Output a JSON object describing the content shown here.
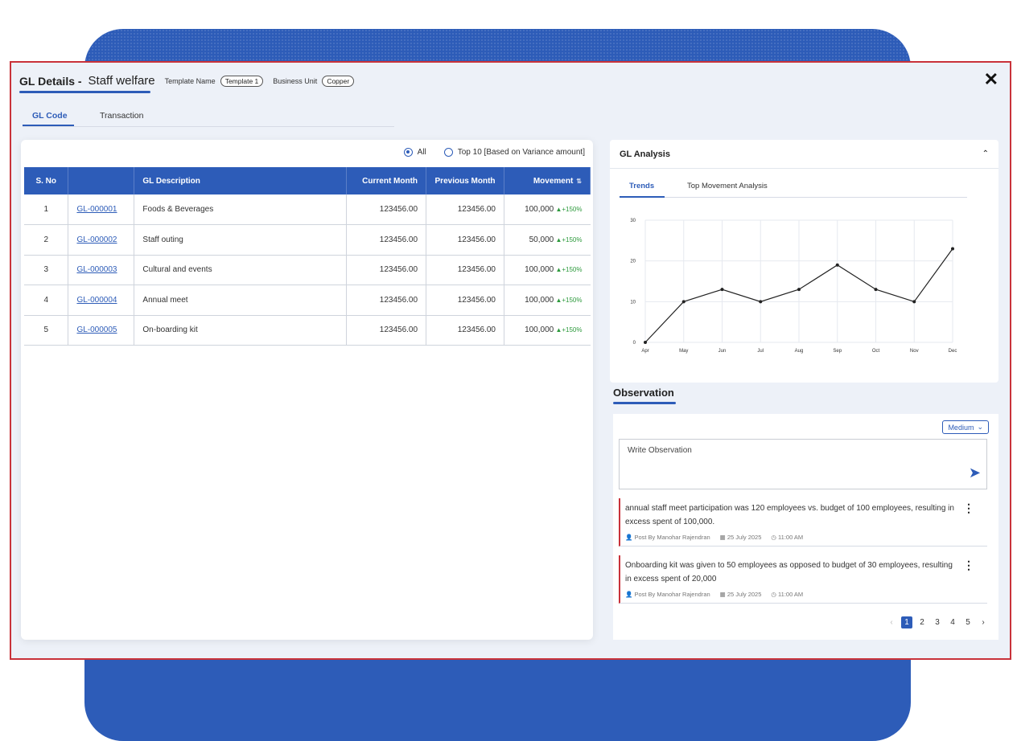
{
  "header": {
    "title_main": "GL Details -",
    "title_sub": "Staff welfare",
    "template_label": "Template Name",
    "template_value": "Template 1",
    "bu_label": "Business Unit",
    "bu_value": "Copper",
    "close_icon": "close-icon"
  },
  "tabs": [
    {
      "label": "GL Code",
      "active": true
    },
    {
      "label": "Transaction",
      "active": false
    }
  ],
  "filters": {
    "all_label": "All",
    "top10_label": "Top 10 [Based on Variance amount]"
  },
  "table": {
    "headers": [
      "S. No",
      "",
      "GL Description",
      "Current Month",
      "Previous Month",
      "Movement"
    ],
    "rows": [
      {
        "sno": "1",
        "code": "GL-000001",
        "desc": "Foods & Beverages",
        "current": "123456.00",
        "previous": "123456.00",
        "movement": "100,000",
        "pct": "+150%"
      },
      {
        "sno": "2",
        "code": "GL-000002",
        "desc": "Staff outing",
        "current": "123456.00",
        "previous": "123456.00",
        "movement": "50,000",
        "pct": "+150%"
      },
      {
        "sno": "3",
        "code": "GL-000003",
        "desc": "Cultural and events",
        "current": "123456.00",
        "previous": "123456.00",
        "movement": "100,000",
        "pct": "+150%"
      },
      {
        "sno": "4",
        "code": "GL-000004",
        "desc": "Annual meet",
        "current": "123456.00",
        "previous": "123456.00",
        "movement": "100,000",
        "pct": "+150%"
      },
      {
        "sno": "5",
        "code": "GL-000005",
        "desc": "On-boarding kit",
        "current": "123456.00",
        "previous": "123456.00",
        "movement": "100,000",
        "pct": "+150%"
      }
    ]
  },
  "analysis": {
    "title": "GL Analysis",
    "tabs": [
      {
        "label": "Trends",
        "active": true
      },
      {
        "label": "Top Movement Analysis",
        "active": false
      }
    ]
  },
  "chart_data": {
    "type": "line",
    "title": "",
    "xlabel": "",
    "ylabel": "",
    "categories": [
      "Apr",
      "May",
      "Jun",
      "Jul",
      "Aug",
      "Sep",
      "Oct",
      "Nov",
      "Dec"
    ],
    "values": [
      0,
      10,
      13,
      10,
      13,
      19,
      13,
      10,
      23
    ],
    "yticks": [
      0,
      10,
      20,
      30
    ],
    "ylim": [
      0,
      30
    ],
    "grid": true
  },
  "observation": {
    "title": "Observation",
    "priority": "Medium",
    "placeholder": "Write Observation",
    "items": [
      {
        "text": "annual staff meet participation was 120 employees vs. budget of 100 employees, resulting in excess spent of 100,000.",
        "author": "Post By Manohar Rajendran",
        "date": "25 July 2025",
        "time": "11:00 AM"
      },
      {
        "text": "Onboarding kit was given to 50 employees as opposed to budget of 30 employees, resulting in excess spent of 20,000",
        "author": "Post By Manohar Rajendran",
        "date": "25 July 2025",
        "time": "11:00 AM"
      }
    ],
    "pages": [
      "1",
      "2",
      "3",
      "4",
      "5"
    ]
  }
}
